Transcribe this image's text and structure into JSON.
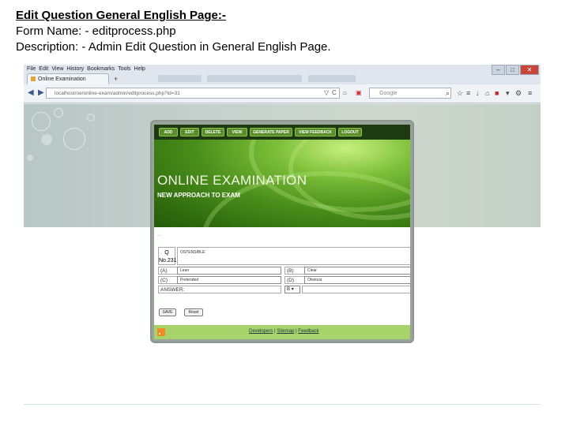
{
  "heading": {
    "title": "Edit Question General English Page:-",
    "form_name": "Form Name: - editprocess.php",
    "description": "Description: - Admin Edit Question in General English Page."
  },
  "browser": {
    "menu": [
      "File",
      "Edit",
      "View",
      "History",
      "Bookmarks",
      "Tools",
      "Help"
    ],
    "tab_title": "Online Examination",
    "new_tab": "+",
    "url": "localhost/oe/online-exam/admin/editprocess.php?id=31",
    "search_placeholder": "Google",
    "window_controls": [
      "–",
      "□",
      "✕"
    ]
  },
  "site": {
    "nav": [
      "ADD",
      "EDIT",
      "DELETE",
      "VIEW",
      "GENERATE PAPER",
      "VIEW FEEDBACK",
      "LOGOUT"
    ],
    "banner_title": "ONLINE EXAMINATION",
    "banner_subtitle": "NEW APPROACH TO EXAM",
    "form": {
      "q_label": "Q",
      "q_no": "No.231",
      "question_text": "OSTENSIBLE",
      "option_a_label": "(A)",
      "option_a": "Lean",
      "option_b_label": "(B)",
      "option_b": "Clear",
      "option_c_label": "(C)",
      "option_c": "Pretended",
      "option_d_label": "(D)",
      "option_d": "Obvious",
      "answer_label": "ANSWER:",
      "answer_value": "B",
      "save_label": "SAVE",
      "reset_label": "Reset"
    },
    "footer": {
      "developers": "Developers",
      "sitemap": "Sitemap",
      "feedback": "Feedback",
      "sep": "|"
    }
  }
}
